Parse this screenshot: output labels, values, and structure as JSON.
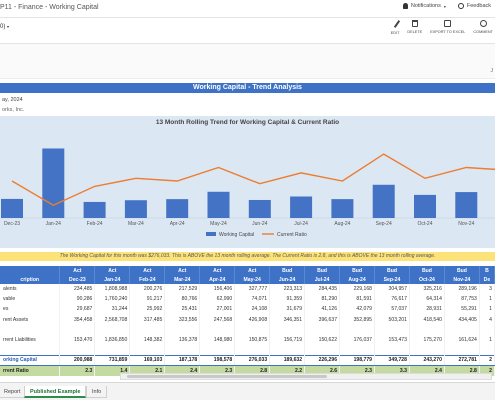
{
  "app": {
    "title": "P11 - Finance - Working Capital",
    "notifications": "Notifications",
    "feedback": "Feedback"
  },
  "toolbar": {
    "selector": "0)",
    "buttons": [
      "EDIT",
      "DELETE",
      "EXPORT TO EXCEL",
      "COMMENT"
    ],
    "side_letter": "J"
  },
  "report": {
    "banner": "Working Capital - Trend Analysis",
    "date": "ay, 2024",
    "company": "orks, Inc.",
    "note": "The Working Capital for this month was $276,033. This is ABOVE the 13 month rolling average. The Current Ratio is 2.8, and this is ABOVE the 13 month rolling average."
  },
  "chart_data": {
    "type": "bar",
    "title": "13 Month Rolling Trend for Working Capital & Current Ratio",
    "categories": [
      "Dec-23",
      "Jan-24",
      "Feb-24",
      "Mar-24",
      "Apr-24",
      "May-24",
      "Jun-24",
      "Jul-24",
      "Aug-24",
      "Sep-24",
      "Oct-24",
      "Nov-24",
      "Dec-24"
    ],
    "x_tick_labels": [
      "Dec-23",
      "Jan-24",
      "Feb-24",
      "Mar-24",
      "Apr-24",
      "May-24",
      "Jun-24",
      "Jul-24",
      "Aug-24",
      "Sep-24",
      "Oct-24",
      "Nov-24",
      ""
    ],
    "series": [
      {
        "name": "Working Capital",
        "type": "bar",
        "color": "#4472c4",
        "values": [
          200988,
          731859,
          169103,
          187178,
          198578,
          276033,
          189632,
          226296,
          198779,
          349728,
          243270,
          272781,
          260000
        ]
      },
      {
        "name": "Current Ratio",
        "type": "line",
        "color": "#ed7d31",
        "values": [
          2.3,
          1.4,
          2.1,
          2.4,
          2.3,
          2.8,
          2.2,
          2.6,
          2.3,
          3.3,
          2.4,
          2.8,
          2.7
        ]
      }
    ],
    "legend_position": "bottom"
  },
  "table": {
    "col_top": [
      "",
      "Act",
      "Act",
      "Act",
      "Act",
      "Act",
      "Act",
      "Bud",
      "Bud",
      "Bud",
      "Bud",
      "Bud",
      "Bud",
      "B"
    ],
    "col_bottom": [
      "cription",
      "Dec-23",
      "Jan-24",
      "Feb-24",
      "Mar-24",
      "Apr-24",
      "May-24",
      "Jun-24",
      "Jul-24",
      "Aug-24",
      "Sep-24",
      "Oct-24",
      "Nov-24",
      "De"
    ],
    "rows": [
      {
        "label": "alents",
        "values": [
          "234,485",
          "1,808,988",
          "200,276",
          "217,529",
          "156,406",
          "327,777",
          "223,313",
          "284,435",
          "229,168",
          "304,957",
          "325,216",
          "289,196",
          "3"
        ]
      },
      {
        "label": "vable",
        "values": [
          "90,286",
          "1,760,240",
          "91,217",
          "80,766",
          "62,990",
          "74,071",
          "91,359",
          "81,290",
          "81,591",
          "76,617",
          "64,314",
          "87,753",
          "1"
        ]
      },
      {
        "label": "es",
        "values": [
          "29,687",
          "31,244",
          "25,992",
          "25,431",
          "27,001",
          "24,108",
          "31,679",
          "41,126",
          "42,079",
          "57,037",
          "28,931",
          "55,291",
          "1"
        ]
      },
      {
        "label": "rent Assets",
        "values": [
          "354,458",
          "2,568,708",
          "317,485",
          "323,556",
          "247,568",
          "426,908",
          "346,351",
          "396,637",
          "352,895",
          "503,201",
          "418,540",
          "434,405",
          "4"
        ]
      },
      {
        "label": "",
        "values": [
          "",
          "",
          "",
          "",
          "",
          "",
          "",
          "",
          "",
          "",
          "",
          "",
          ""
        ]
      },
      {
        "label": "rrent Liabilities",
        "values": [
          "153,470",
          "1,836,850",
          "148,382",
          "136,378",
          "148,980",
          "150,875",
          "156,719",
          "150,622",
          "176,037",
          "153,473",
          "175,270",
          "161,624",
          "1"
        ]
      },
      {
        "label": "",
        "values": [
          "",
          "",
          "",
          "",
          "",
          "",
          "",
          "",
          "",
          "",
          "",
          "",
          ""
        ]
      }
    ],
    "total_row": {
      "label": "orking Capital",
      "values": [
        "200,988",
        "731,859",
        "169,103",
        "187,178",
        "198,578",
        "276,033",
        "189,632",
        "226,296",
        "198,779",
        "349,728",
        "243,270",
        "272,781",
        "2"
      ]
    },
    "ratio_row": {
      "label": "rrent Ratio",
      "values": [
        "2.3",
        "1.4",
        "2.1",
        "2.4",
        "2.3",
        "2.8",
        "2.2",
        "2.6",
        "2.3",
        "3.3",
        "2.4",
        "2.8",
        "2"
      ]
    }
  },
  "tabs": [
    "Report",
    "Published Example",
    "Info"
  ]
}
